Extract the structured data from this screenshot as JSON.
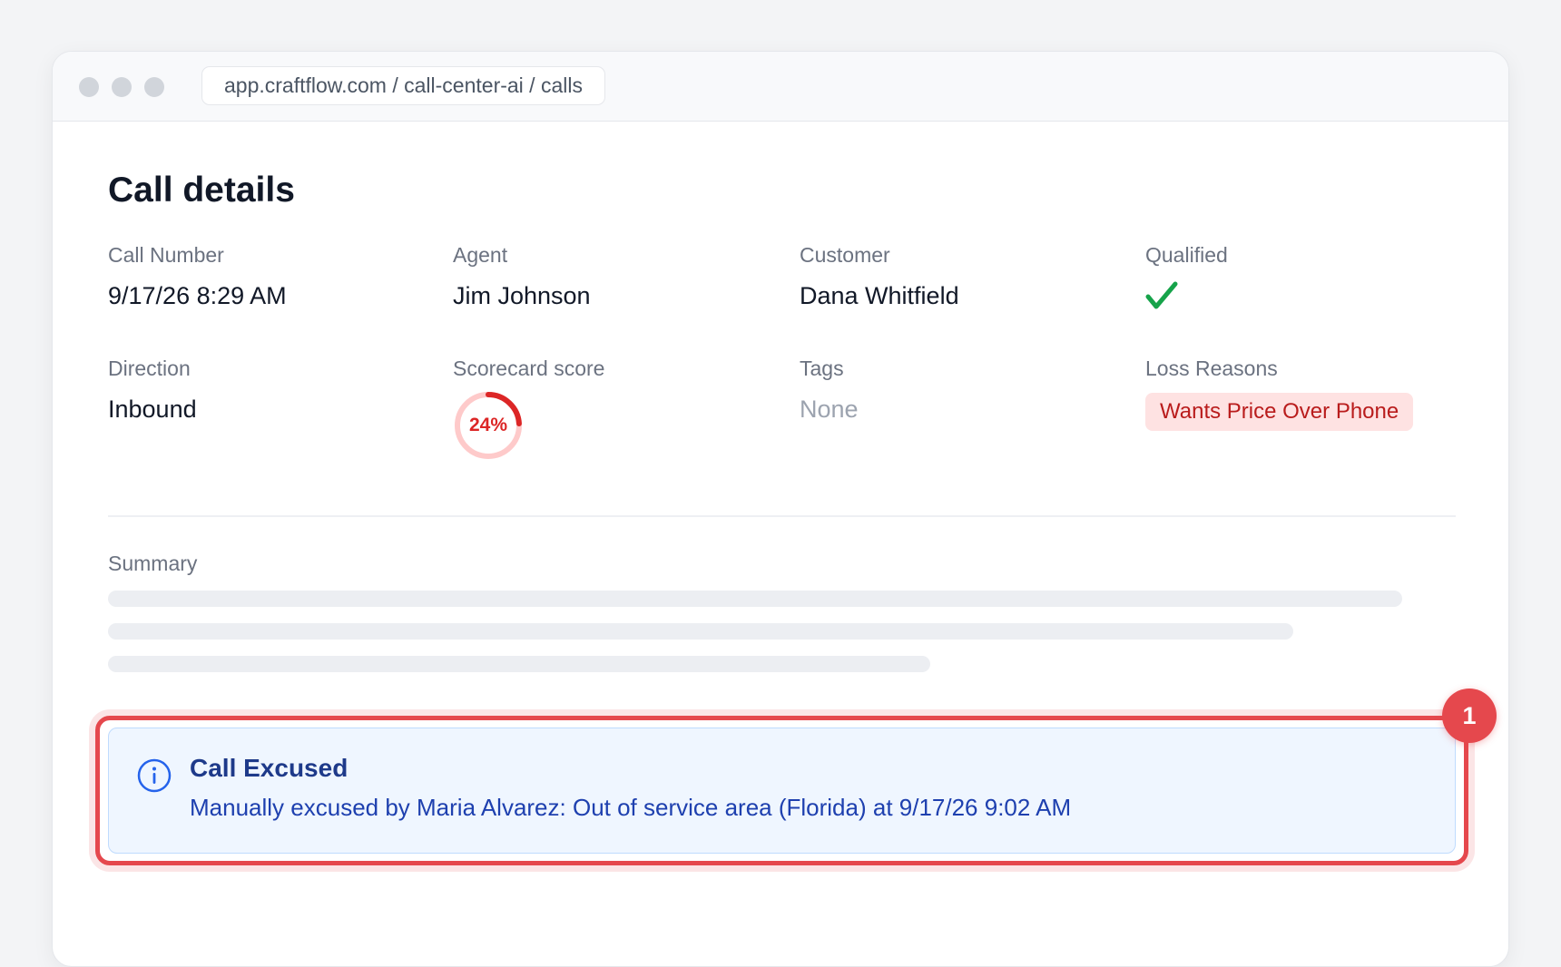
{
  "browser": {
    "url": "app.craftflow.com / call-center-ai / calls"
  },
  "page": {
    "title": "Call details"
  },
  "fields": {
    "call_number": {
      "label": "Call Number",
      "value": "9/17/26 8:29 AM"
    },
    "agent": {
      "label": "Agent",
      "value": "Jim Johnson"
    },
    "customer": {
      "label": "Customer",
      "value": "Dana Whitfield"
    },
    "qualified": {
      "label": "Qualified",
      "value": true,
      "icon": "check-icon",
      "color": "#16a34a"
    },
    "direction": {
      "label": "Direction",
      "value": "Inbound"
    },
    "scorecard": {
      "label": "Scorecard score",
      "value": "24%",
      "percent": 24,
      "color": "#dc2626"
    },
    "tags": {
      "label": "Tags",
      "value": "None"
    },
    "loss_reasons": {
      "label": "Loss Reasons",
      "items": [
        "Wants Price Over Phone"
      ]
    }
  },
  "summary": {
    "label": "Summary"
  },
  "notice": {
    "icon": "info-icon",
    "title": "Call Excused",
    "text": "Manually excused by Maria Alvarez: Out of service area (Florida) at 9/17/26 9:02 AM"
  },
  "annotation": {
    "badge": "1",
    "color": "#e5484d"
  }
}
